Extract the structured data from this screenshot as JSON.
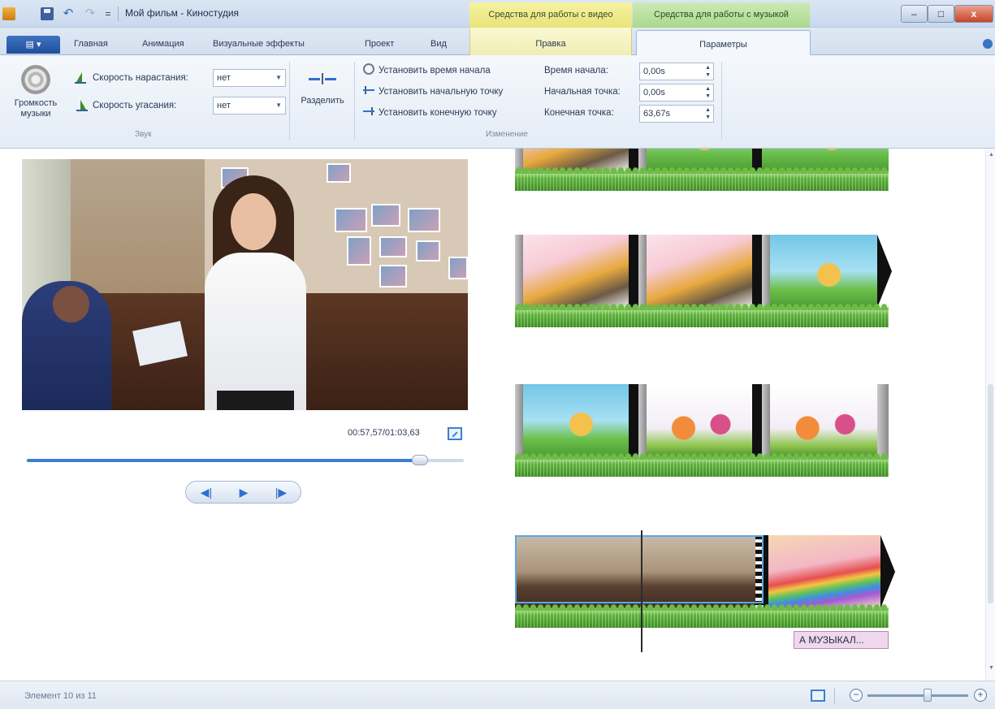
{
  "window": {
    "title": "Мой фильм - Киностудия",
    "context_video_label": "Средства для работы с видео",
    "context_music_label": "Средства для работы с музыкой",
    "minimize": "–",
    "maximize": "□",
    "close": "x"
  },
  "quick_access": {
    "undo_glyph": "↶",
    "redo_glyph": "↷",
    "menu_glyph": "="
  },
  "tabs": {
    "app_menu": "▤ ▾",
    "home": "Главная",
    "animation": "Анимация",
    "visual_effects": "Визуальные эффекты",
    "project": "Проект",
    "view": "Вид",
    "edit": "Правка",
    "options": "Параметры"
  },
  "ribbon": {
    "music_volume_label": "Громкость музыки",
    "fade_in_label": "Скорость нарастания:",
    "fade_in_value": "нет",
    "fade_out_label": "Скорость угасания:",
    "fade_out_value": "нет",
    "sound_group": "Звук",
    "split_label": "Разделить",
    "set_start_time": "Установить время начала",
    "set_start_point": "Установить начальную точку",
    "set_end_point": "Установить конечную точку",
    "start_time_label": "Время начала:",
    "start_time_value": "0,00s",
    "start_point_label": "Начальная точка:",
    "start_point_value": "0,00s",
    "end_point_label": "Конечная точка:",
    "end_point_value": "63,67s",
    "editing_group": "Изменение",
    "spinner_glyph": "▲\n▼"
  },
  "preview": {
    "time": "00:57,57/01:03,63",
    "seek_progress": 0.9,
    "prev_glyph": "◀|",
    "play_glyph": "▶",
    "next_glyph": "|▶"
  },
  "timeline": {
    "caption": "А МУЗЫКАЛ..."
  },
  "status": {
    "text": "Элемент 10 из 11",
    "zoom_out": "−",
    "zoom_in": "+",
    "zoom_level": 0.6
  },
  "icons": [
    "app-icon",
    "save-icon",
    "undo-icon",
    "redo-icon",
    "speaker-icon",
    "fade-in-icon",
    "fade-out-icon",
    "split-icon",
    "clock-icon",
    "set-start-point-icon",
    "set-end-point-icon",
    "fullscreen-icon",
    "aspect-ratio-icon",
    "help-icon"
  ],
  "colors": {
    "accent": "#3b7fd0",
    "video_tools": "#f0edb3",
    "music_tools": "#a9d88c",
    "caption": "#f0d8ec"
  }
}
